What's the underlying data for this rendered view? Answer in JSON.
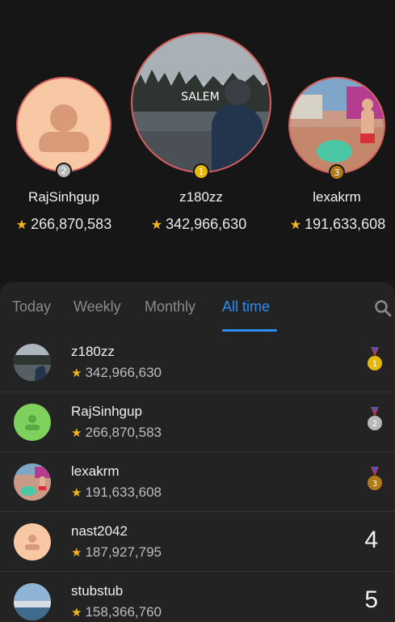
{
  "podium": [
    {
      "id": "pod1",
      "rank": "1",
      "name": "z180zz",
      "score": "342,966,630",
      "photo_text": "SALEM"
    },
    {
      "id": "pod2",
      "rank": "2",
      "name": "RajSinhgup",
      "score": "266,870,583"
    },
    {
      "id": "pod3",
      "rank": "3",
      "name": "lexakrm",
      "score": "191,633,608"
    }
  ],
  "tabs": [
    {
      "label": "Today",
      "active": false
    },
    {
      "label": "Weekly",
      "active": false
    },
    {
      "label": "Monthly",
      "active": false
    },
    {
      "label": "All time",
      "active": true
    }
  ],
  "rows": [
    {
      "name": "z180zz",
      "score": "342,966,630",
      "rank": "1",
      "badge": "gold-medal"
    },
    {
      "name": "RajSinhgup",
      "score": "266,870,583",
      "rank": "2",
      "badge": "silver-medal"
    },
    {
      "name": "lexakrm",
      "score": "191,633,608",
      "rank": "3",
      "badge": "bronze-medal"
    },
    {
      "name": "nast2042",
      "score": "187,927,795",
      "rank": "4"
    },
    {
      "name": "stubstub",
      "score": "158,366,760",
      "rank": "5"
    }
  ],
  "colors": {
    "accent": "#2d8cf0",
    "star": "#f2b51c",
    "gold": "#e5b80b",
    "silver": "#b8b8b8",
    "bronze": "#b07a17"
  }
}
